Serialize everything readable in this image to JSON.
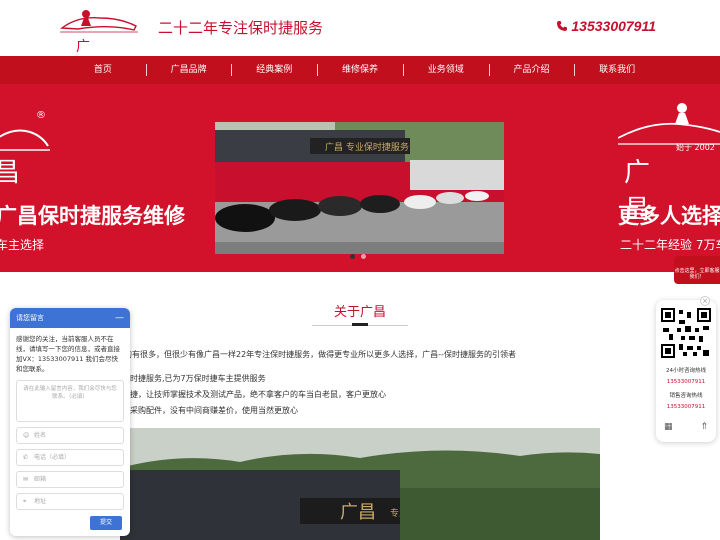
{
  "header": {
    "logo_text": "广 昌",
    "slogan": "二十二年专注保时捷服务",
    "phone": "13533007911"
  },
  "nav": {
    "items": [
      {
        "label": "首页"
      },
      {
        "label": "广昌品牌"
      },
      {
        "label": "经典案例"
      },
      {
        "label": "维修保养"
      },
      {
        "label": "业务领域"
      },
      {
        "label": "产品介绍"
      },
      {
        "label": "联系我们"
      }
    ]
  },
  "banner": {
    "reg_mark": "®",
    "left_brand": "昌",
    "left_title": "广昌保时捷服务维修",
    "left_sub": "车主选择",
    "right_since": "始于 2002",
    "right_brand": "广昌",
    "right_title": "更多人选择",
    "right_sub": "二十二年经验 7万车"
  },
  "about": {
    "title": "关于广昌",
    "lines": [
      "的有很多，但很少有像广昌一样22年专注保时捷服务，做得更专业所以更多人选择，广昌--保时捷服务的引领者",
      "时捷服务,已为7万保时捷车主提供服务",
      "捷，让技师掌握技术及测试产品，绝不拿客户的车当白老鼠，客户更放心",
      "采购配件，没有中间商赚差价，使用当然更放心"
    ]
  },
  "chat": {
    "title": "请您留言",
    "minimize": "—",
    "message": "感谢您的关注，当前客服人员不在线，请填写一下您的信息，或者直接加VX：13533007911 我们会尽快和您联系。",
    "textarea_placeholder": "请在此输入留言内容，我们会尽快与您联系。（必填）",
    "fields": [
      {
        "icon": "user-icon",
        "placeholder": "姓名"
      },
      {
        "icon": "phone-icon",
        "placeholder": "电话（必填）"
      },
      {
        "icon": "mail-icon",
        "placeholder": "邮箱"
      },
      {
        "icon": "location-icon",
        "placeholder": "地址"
      }
    ],
    "submit": "提交"
  },
  "float": {
    "red_tab_line1": "点击这里，立即客服我们！",
    "hotline_label": "24小时咨询热线",
    "hotline": "13533007911",
    "sales_label": "销售咨询热线",
    "sales_phone": "13533007911",
    "close": "×"
  },
  "colors": {
    "brand_red": "#c20f1e",
    "chat_blue": "#3d73d4"
  }
}
